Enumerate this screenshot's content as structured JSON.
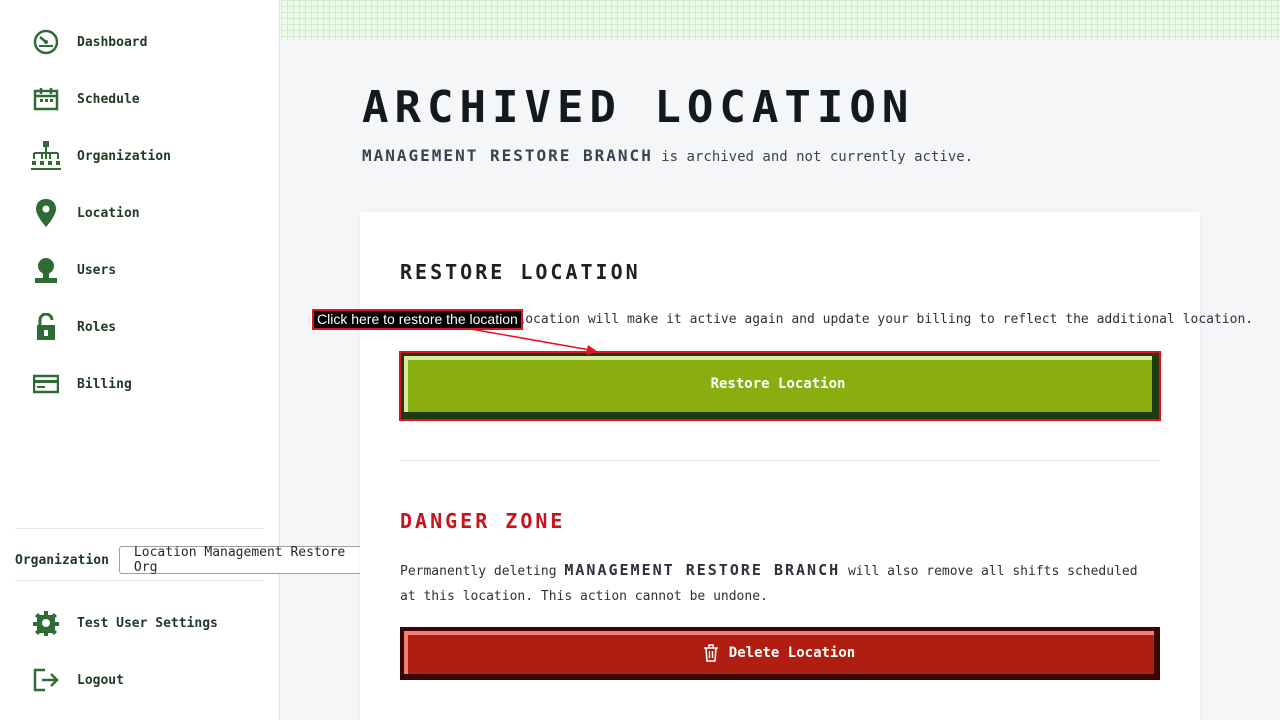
{
  "sidebar": {
    "items": [
      {
        "label": "Dashboard",
        "icon": "dashboard-icon"
      },
      {
        "label": "Schedule",
        "icon": "calendar-icon"
      },
      {
        "label": "Organization",
        "icon": "org-chart-icon"
      },
      {
        "label": "Location",
        "icon": "location-pin-icon"
      },
      {
        "label": "Users",
        "icon": "user-icon"
      },
      {
        "label": "Roles",
        "icon": "lock-icon"
      },
      {
        "label": "Billing",
        "icon": "credit-card-icon"
      }
    ],
    "org_label": "Organization",
    "org_selected": "Location Management Restore Org",
    "settings_label": "Test User Settings",
    "logout_label": "Logout"
  },
  "main": {
    "title": "Archived Location",
    "subtitle_name": "Management Restore Branch",
    "subtitle_rest": " is archived and not currently active.",
    "restore": {
      "heading": "Restore Location",
      "text": "Restoring this location will make it active again and update your billing to reflect the additional location.",
      "button_label": "Restore Location"
    },
    "danger": {
      "heading": "Danger Zone",
      "text_before": "Permanently deleting ",
      "text_name": "Management Restore Branch",
      "text_after": " will also remove all shifts scheduled at this location. This action cannot be undone.",
      "button_label": "Delete Location"
    }
  },
  "annotation": {
    "label": "Click here to restore the location"
  },
  "colors": {
    "accent_green": "#8aad10",
    "danger_red": "#b01e12",
    "icon_green": "#2e6b35",
    "annotation_red": "#e0141e"
  }
}
